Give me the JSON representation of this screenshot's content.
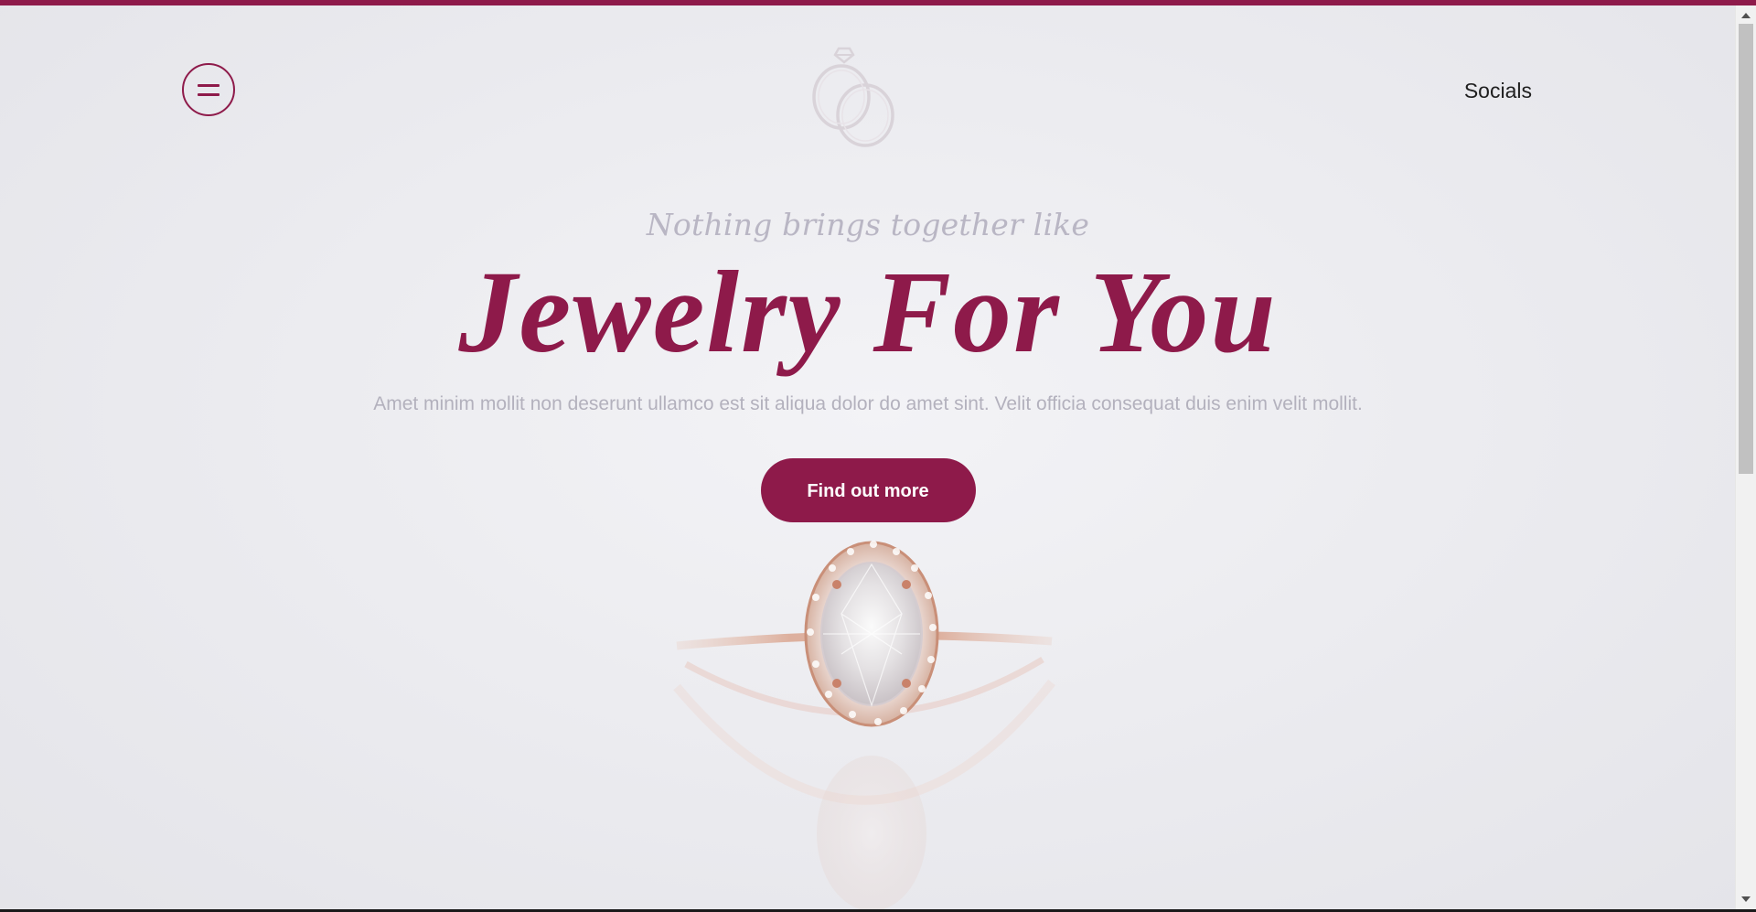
{
  "theme": {
    "accent": "#8e1a4a",
    "eyebrow_color": "#b9b6c4",
    "description_color": "#b3b1bd",
    "background": "#ececf0"
  },
  "header": {
    "menu_icon": "hamburger-icon",
    "logo_icon": "wedding-rings-logo",
    "socials_label": "Socials"
  },
  "hero": {
    "eyebrow": "Nothing brings together like",
    "headline": "Jewelry For You",
    "description": "Amet minim mollit non deserunt ullamco est sit aliqua dolor do amet sint. Velit officia consequat duis enim velit mollit.",
    "cta_label": "Find out more",
    "image_icon": "diamond-ring-image"
  }
}
